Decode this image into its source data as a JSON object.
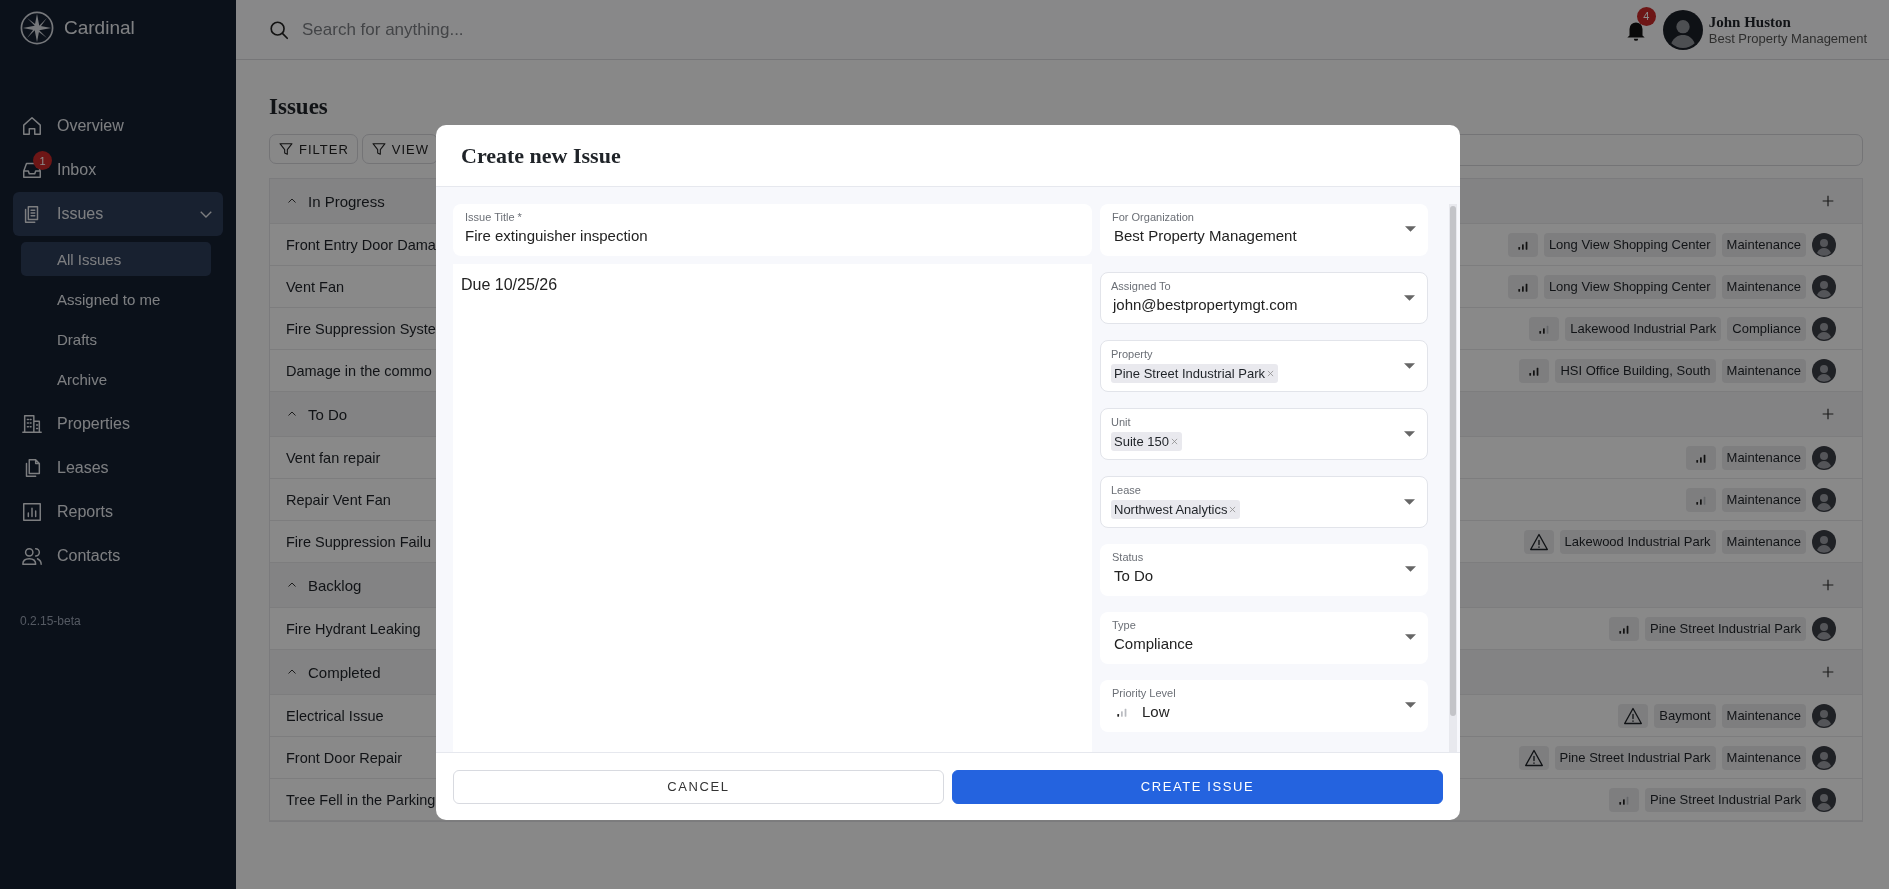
{
  "app": {
    "name": "Cardinal",
    "version": "0.2.15-beta"
  },
  "sidebar": {
    "items": [
      {
        "label": "Overview",
        "selected": false
      },
      {
        "label": "Inbox",
        "selected": false,
        "badge": "1"
      },
      {
        "label": "Issues",
        "selected": true,
        "expanded": true,
        "children": [
          {
            "label": "All Issues",
            "selected": true
          },
          {
            "label": "Assigned to me",
            "selected": false
          },
          {
            "label": "Drafts",
            "selected": false
          },
          {
            "label": "Archive",
            "selected": false
          }
        ]
      },
      {
        "label": "Properties",
        "selected": false
      },
      {
        "label": "Leases",
        "selected": false
      },
      {
        "label": "Reports",
        "selected": false
      },
      {
        "label": "Contacts",
        "selected": false
      }
    ]
  },
  "topbar": {
    "search": {
      "placeholder": "Search for anything..."
    },
    "notifications": "4",
    "user": {
      "name": "John Huston",
      "organization": "Best Property Management"
    }
  },
  "page": {
    "title": "Issues",
    "toolbar": [
      "FILTER",
      "VIEW"
    ],
    "groups": [
      {
        "title": "In Progress",
        "expanded": true,
        "rows": [
          {
            "title": "Front Entry Door Dama",
            "priority_icon": {
              "kind": "high"
            },
            "tags": [
              "Long View Shopping Center",
              "Maintenance"
            ]
          },
          {
            "title": "Vent Fan",
            "priority_icon": {
              "kind": "high"
            },
            "tags": [
              "Long View Shopping Center",
              "Maintenance"
            ]
          },
          {
            "title": "Fire Suppression Syste",
            "priority_icon": {
              "kind": "medium"
            },
            "tags": [
              "Lakewood Industrial Park",
              "Compliance"
            ]
          },
          {
            "title": "Damage in the commo",
            "priority_icon": {
              "kind": "high"
            },
            "tags": [
              "HSI Office Building, South",
              "Maintenance"
            ]
          }
        ]
      },
      {
        "title": "To Do",
        "expanded": true,
        "rows": [
          {
            "title": "Vent fan repair",
            "priority_icon": {
              "kind": "high"
            },
            "tags": [
              "Maintenance"
            ]
          },
          {
            "title": "Repair Vent Fan",
            "priority_icon": {
              "kind": "medium"
            },
            "tags": [
              "Maintenance"
            ]
          },
          {
            "title": "Fire Suppression Failu",
            "priority_icon": {
              "kind": "urgent"
            },
            "tags": [
              "Lakewood Industrial Park",
              "Maintenance"
            ]
          }
        ]
      },
      {
        "title": "Backlog",
        "expanded": true,
        "rows": [
          {
            "title": "Fire Hydrant Leaking",
            "priority_icon": {
              "kind": "high"
            },
            "tags": [
              "Pine Street Industrial Park"
            ]
          }
        ]
      },
      {
        "title": "Completed",
        "expanded": true,
        "rows": [
          {
            "title": "Electrical Issue",
            "priority_icon": {
              "kind": "urgent"
            },
            "tags": [
              "Baymont",
              "Maintenance"
            ]
          },
          {
            "title": "Front Door Repair",
            "priority_icon": {
              "kind": "urgent"
            },
            "tags": [
              "Pine Street Industrial Park",
              "Maintenance"
            ]
          },
          {
            "title": "Tree Fell in the Parking",
            "priority_icon": {
              "kind": "medium"
            },
            "tags": [
              "Pine Street Industrial Park"
            ]
          }
        ]
      }
    ]
  },
  "modal": {
    "title": "Create new Issue",
    "issue_title": {
      "label": "Issue Title *",
      "value": "Fire extinguisher inspection"
    },
    "description": "Due 10/25/26",
    "fields": [
      {
        "kind": "select",
        "label": "For Organization",
        "value": "Best Property Management"
      },
      {
        "kind": "autocomplete",
        "label": "Assigned To",
        "value": "john@bestpropertymgt.com"
      },
      {
        "kind": "autocomplete",
        "label": "Property",
        "chips": [
          "Pine Street Industrial Park"
        ]
      },
      {
        "kind": "autocomplete",
        "label": "Unit",
        "chips": [
          "Suite 150"
        ]
      },
      {
        "kind": "autocomplete",
        "label": "Lease",
        "chips": [
          "Northwest Analytics"
        ]
      },
      {
        "kind": "select",
        "label": "Status",
        "value": "To Do"
      },
      {
        "kind": "select",
        "label": "Type",
        "value": "Compliance"
      },
      {
        "kind": "select",
        "label": "Priority Level",
        "value": "Low",
        "priority_icon": {
          "kind": "low"
        }
      }
    ],
    "buttons": [
      {
        "kind": "secondary",
        "label": "CANCEL"
      },
      {
        "kind": "primary",
        "label": "CREATE ISSUE"
      }
    ]
  }
}
